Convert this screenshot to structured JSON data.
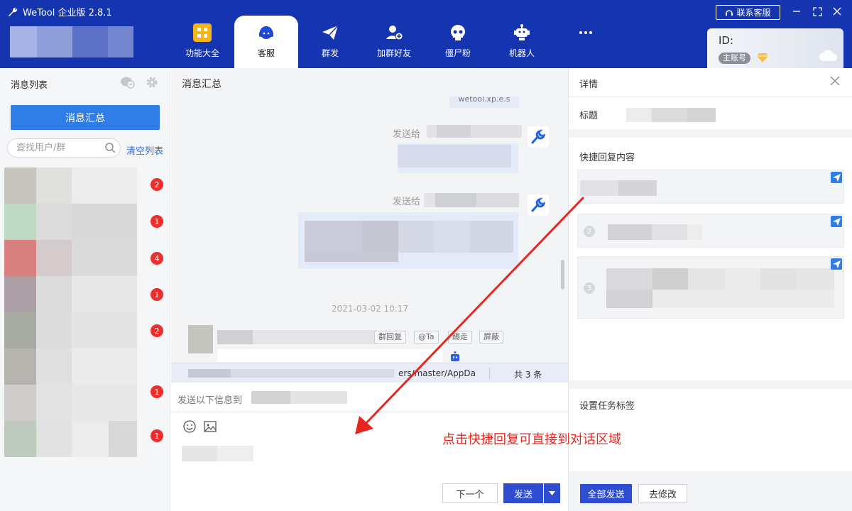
{
  "app": {
    "title": "WeTool 企业版 2.8.1",
    "contact_label": "联系客服",
    "id_label": "ID:",
    "main_account_badge": "主账号"
  },
  "nav": [
    {
      "label": "功能大全",
      "icon": "grid-icon"
    },
    {
      "label": "客服",
      "icon": "headset-icon",
      "active": true
    },
    {
      "label": "群发",
      "icon": "paper-plane-icon"
    },
    {
      "label": "加群好友",
      "icon": "add-friend-icon"
    },
    {
      "label": "僵尸粉",
      "icon": "skull-icon"
    },
    {
      "label": "机器人",
      "icon": "robot-icon"
    },
    {
      "label": "",
      "icon": "more-icon"
    }
  ],
  "left": {
    "title": "消息列表",
    "summary_button": "消息汇总",
    "search_placeholder": "查找用户/群",
    "clear_list": "清空列表",
    "badges": [
      "2",
      "1",
      "4",
      "1",
      "2",
      "1",
      "1"
    ]
  },
  "center": {
    "title": "消息汇总",
    "bubble_top_text": "wetool.xp.e.s",
    "sent_label_1": "发送给",
    "sent_label_2": "发送给",
    "timestamp": "2021-03-02 10:17",
    "tags": [
      "群回复",
      "@Ta",
      "踢走",
      "屏蔽"
    ],
    "info_path": "ers/master/AppDa",
    "info_count": "共 3 条",
    "send_to_label": "发送以下信息到",
    "next_button": "下一个",
    "send_button": "发送"
  },
  "right": {
    "title": "详情",
    "title_field": "标题",
    "quick_reply_label": "快捷回复内容",
    "quick_reply_numbers": [
      "2",
      "3"
    ],
    "task_tag_label": "设置任务标签",
    "all_send_button": "全部发送",
    "modify_button": "去修改"
  },
  "annotation": {
    "text": "点击快捷回复可直接到对话区域",
    "color": "#e8261f"
  },
  "colors": {
    "topbar": "#1535b0",
    "primary": "#2f4dd0",
    "accent": "#2f7ee8",
    "badge": "#ef2d2d"
  }
}
